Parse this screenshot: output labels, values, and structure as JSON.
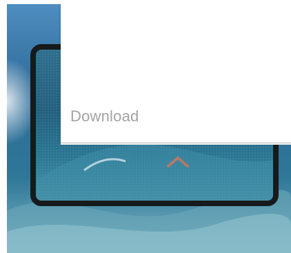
{
  "menu": {
    "download_label": "Download"
  },
  "icons": {
    "collapse": "chevron-up-icon"
  },
  "colors": {
    "panel_background": "#ffffff",
    "label_text": "#a3a3a3",
    "frame": "#161a1c",
    "chevron": "#b07a6a"
  }
}
